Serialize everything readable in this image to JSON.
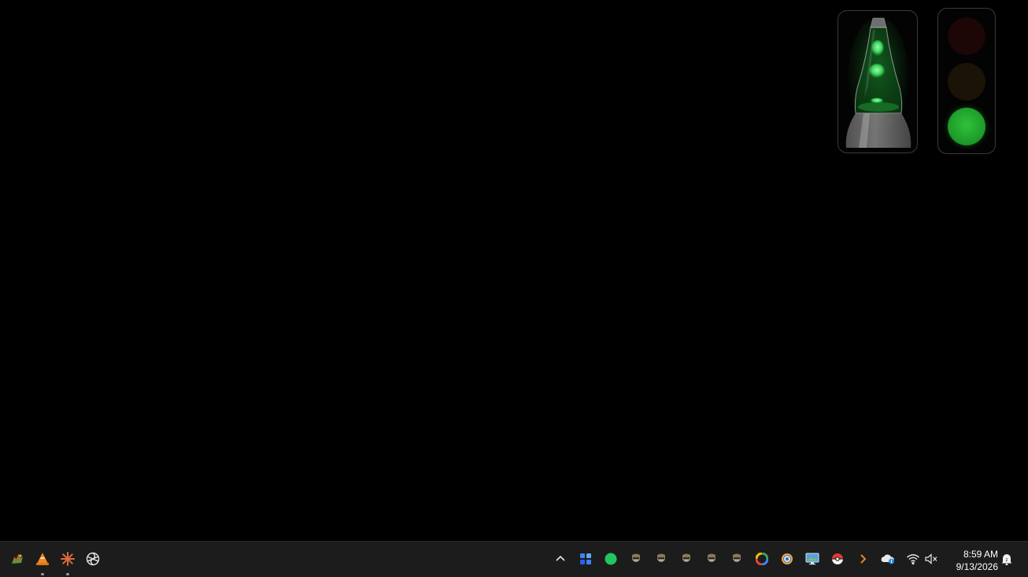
{
  "desktop": {
    "widgets": {
      "lava_lamp": {
        "name": "lava-lamp",
        "accent": "#3ad05a"
      },
      "traffic_light": {
        "lights": [
          {
            "color": "red",
            "state": "off"
          },
          {
            "color": "yellow",
            "state": "off"
          },
          {
            "color": "green",
            "state": "on"
          }
        ]
      }
    }
  },
  "taskbar": {
    "pinned_apps": [
      {
        "icon": "dragon-app-icon",
        "running": false
      },
      {
        "icon": "cone-app-icon",
        "running": true
      },
      {
        "icon": "starburst-app-icon",
        "running": true
      },
      {
        "icon": "knot-app-icon",
        "running": false
      }
    ],
    "tray": {
      "overflow_icon": "chevron-up-icon",
      "icons": [
        "grid-app-icon",
        "green-circle-icon",
        "badge-icon-1",
        "badge-icon-2",
        "badge-icon-3",
        "badge-icon-4",
        "badge-icon-5",
        "google-icon",
        "camera-lens-icon",
        "display-icon",
        "pokeball-icon",
        "orange-chevron-icon",
        "cloud-info-icon",
        "wifi-icon",
        "volume-muted-icon"
      ],
      "clock": {
        "time": "8:59 AM",
        "date": "9/13/2026"
      },
      "notification_icon": "notification-bell-icon"
    }
  },
  "colors": {
    "taskbar_bg": "#1c1c1c",
    "desktop_bg": "#000000",
    "traffic_green": "#1e9e2a",
    "traffic_red_off": "#1c0606",
    "traffic_yellow_off": "#1a1306"
  }
}
